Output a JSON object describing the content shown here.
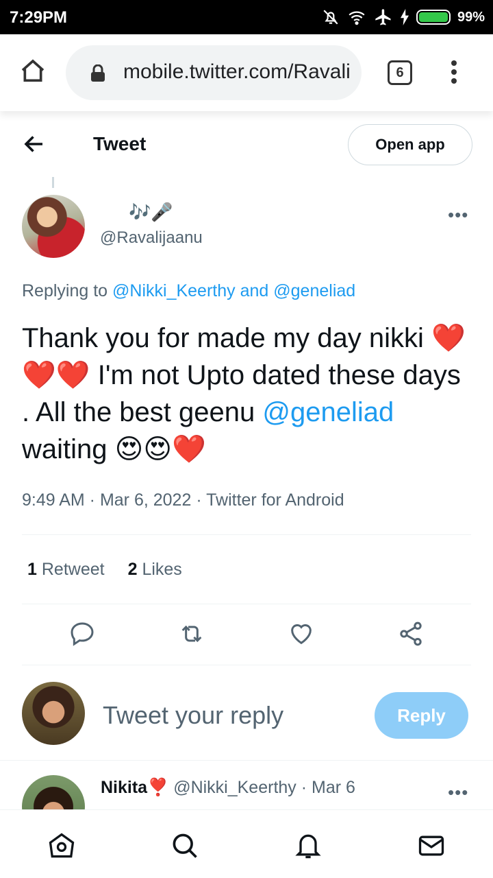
{
  "status_bar": {
    "time": "7:29PM",
    "battery_percent": "99%",
    "battery_level": 0.99,
    "icons": [
      "bell-off-icon",
      "wifi-icon",
      "airplane-icon",
      "charging-icon",
      "battery-icon"
    ]
  },
  "browser": {
    "url": "mobile.twitter.com/Ravalijaanu",
    "tab_count": "6"
  },
  "header": {
    "title": "Tweet",
    "open_app_label": "Open app"
  },
  "tweet": {
    "display_name_emoji": "🎶🎤",
    "handle": "@Ravalijaanu",
    "replying_prefix": "Replying to",
    "replying_to_1": "@Nikki_Keerthy",
    "replying_and": "and",
    "replying_to_2": "@geneliad",
    "text_part1": "Thank you for made my day nikki ❤️❤️❤️ I'm not Upto dated these days .  All the best geenu",
    "text_mention": "@geneliad",
    "text_part2": "waiting 😍😍❤️",
    "time": "9:49 AM",
    "date": "Mar 6, 2022",
    "source": "Twitter for Android",
    "retweets_count": "1",
    "retweets_label": "Retweet",
    "likes_count": "2",
    "likes_label": "Likes"
  },
  "reply_box": {
    "placeholder": "Tweet your reply",
    "button_label": "Reply"
  },
  "next_tweet": {
    "name": "Nikita",
    "name_emoji": "❣️",
    "handle": "@Nikki_Keerthy",
    "date": "Mar 6"
  },
  "colors": {
    "link": "#1d9bf0",
    "reply_button": "#8ecdf8",
    "secondary_text": "#536471"
  }
}
